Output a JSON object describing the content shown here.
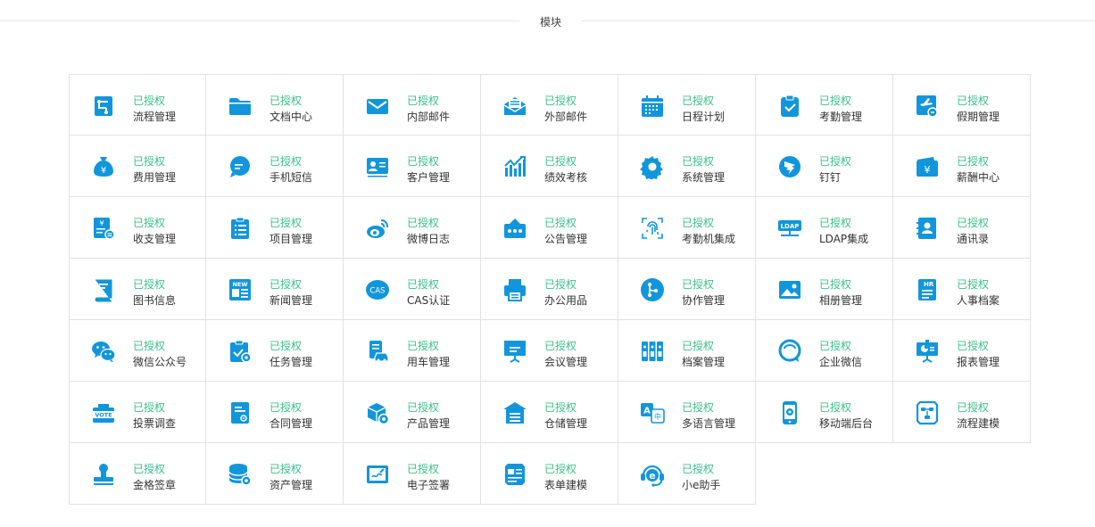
{
  "section": {
    "title": "模块"
  },
  "accent_color": "#1296db",
  "status_color": "#3cc08a",
  "modules": [
    {
      "status": "已授权",
      "name": "流程管理",
      "icon": "workflow-icon"
    },
    {
      "status": "已授权",
      "name": "文档中心",
      "icon": "folder-icon"
    },
    {
      "status": "已授权",
      "name": "内部邮件",
      "icon": "mail-icon"
    },
    {
      "status": "已授权",
      "name": "外部邮件",
      "icon": "mail-open-icon"
    },
    {
      "status": "已授权",
      "name": "日程计划",
      "icon": "calendar-icon"
    },
    {
      "status": "已授权",
      "name": "考勤管理",
      "icon": "clipboard-check-icon"
    },
    {
      "status": "已授权",
      "name": "假期管理",
      "icon": "vacation-icon"
    },
    {
      "status": "已授权",
      "name": "费用管理",
      "icon": "money-bag-icon"
    },
    {
      "status": "已授权",
      "name": "手机短信",
      "icon": "sms-icon"
    },
    {
      "status": "已授权",
      "name": "客户管理",
      "icon": "customer-card-icon"
    },
    {
      "status": "已授权",
      "name": "绩效考核",
      "icon": "bar-chart-icon"
    },
    {
      "status": "已授权",
      "name": "系统管理",
      "icon": "gear-icon"
    },
    {
      "status": "已授权",
      "name": "钉钉",
      "icon": "dingtalk-icon"
    },
    {
      "status": "已授权",
      "name": "薪酬中心",
      "icon": "wallet-icon"
    },
    {
      "status": "已授权",
      "name": "收支管理",
      "icon": "finance-doc-icon"
    },
    {
      "status": "已授权",
      "name": "项目管理",
      "icon": "clipboard-list-icon"
    },
    {
      "status": "已授权",
      "name": "微博日志",
      "icon": "weibo-icon"
    },
    {
      "status": "已授权",
      "name": "公告管理",
      "icon": "notice-board-icon"
    },
    {
      "status": "已授权",
      "name": "考勤机集成",
      "icon": "fingerprint-icon"
    },
    {
      "status": "已授权",
      "name": "LDAP集成",
      "icon": "ldap-icon"
    },
    {
      "status": "已授权",
      "name": "通讯录",
      "icon": "contacts-icon"
    },
    {
      "status": "已授权",
      "name": "图书信息",
      "icon": "book-icon"
    },
    {
      "status": "已授权",
      "name": "新闻管理",
      "icon": "news-icon"
    },
    {
      "status": "已授权",
      "name": "CAS认证",
      "icon": "cas-icon"
    },
    {
      "status": "已授权",
      "name": "办公用品",
      "icon": "printer-icon"
    },
    {
      "status": "已授权",
      "name": "协作管理",
      "icon": "collaboration-icon"
    },
    {
      "status": "已授权",
      "name": "相册管理",
      "icon": "image-icon"
    },
    {
      "status": "已授权",
      "name": "人事档案",
      "icon": "hr-doc-icon"
    },
    {
      "status": "已授权",
      "name": "微信公众号",
      "icon": "wechat-icon"
    },
    {
      "status": "已授权",
      "name": "任务管理",
      "icon": "task-icon"
    },
    {
      "status": "已授权",
      "name": "用车管理",
      "icon": "car-icon"
    },
    {
      "status": "已授权",
      "name": "会议管理",
      "icon": "meeting-board-icon"
    },
    {
      "status": "已授权",
      "name": "档案管理",
      "icon": "archive-binders-icon"
    },
    {
      "status": "已授权",
      "name": "企业微信",
      "icon": "enterprise-wechat-icon"
    },
    {
      "status": "已授权",
      "name": "报表管理",
      "icon": "report-board-icon"
    },
    {
      "status": "已授权",
      "name": "投票调查",
      "icon": "vote-icon"
    },
    {
      "status": "已授权",
      "name": "合同管理",
      "icon": "contract-icon"
    },
    {
      "status": "已授权",
      "name": "产品管理",
      "icon": "product-box-icon"
    },
    {
      "status": "已授权",
      "name": "仓储管理",
      "icon": "warehouse-icon"
    },
    {
      "status": "已授权",
      "name": "多语言管理",
      "icon": "translate-icon"
    },
    {
      "status": "已授权",
      "name": "移动端后台",
      "icon": "mobile-settings-icon"
    },
    {
      "status": "已授权",
      "name": "流程建模",
      "icon": "process-model-icon"
    },
    {
      "status": "已授权",
      "name": "金格签章",
      "icon": "stamp-icon"
    },
    {
      "status": "已授权",
      "name": "资产管理",
      "icon": "database-icon"
    },
    {
      "status": "已授权",
      "name": "电子签署",
      "icon": "e-sign-icon"
    },
    {
      "status": "已授权",
      "name": "表单建模",
      "icon": "form-model-icon"
    },
    {
      "status": "已授权",
      "name": "小e助手",
      "icon": "assistant-icon"
    }
  ]
}
